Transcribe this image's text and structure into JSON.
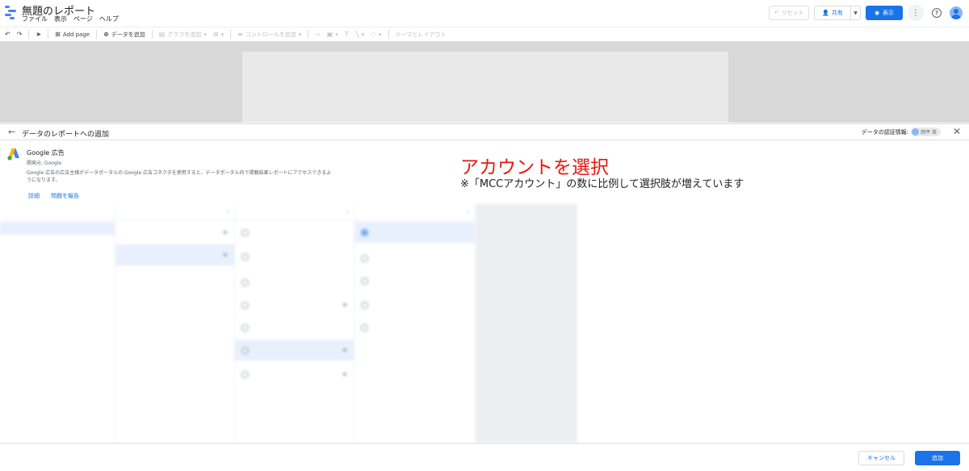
{
  "app": {
    "title": "無題のレポート",
    "menu": [
      "ファイル",
      "表示",
      "ページ",
      "ヘルプ"
    ],
    "reset_label": "リセット",
    "share_label": "共有",
    "view_label": "表示"
  },
  "toolbar": {
    "add_page": "Add page",
    "add_data": "データを追加",
    "add_chart": "グラフを追加",
    "add_control": "コントロールを追加",
    "theme_layout": "テーマとレイアウト"
  },
  "panel": {
    "title": "データのレポートへの追加",
    "credentials_label": "データの認証情報:",
    "credentials_user": "岡平 英"
  },
  "connector": {
    "name": "Google 広告",
    "developer": "開発元: Google",
    "description": "Google 広告の広告主様がデータポータルの Google 広告コネクタを使用すると、データポータル内で掲載結果レポートにアクセスできるようになります。",
    "link_details": "詳細",
    "link_report": "問題を報告"
  },
  "annotation": {
    "title": "アカウントを選択",
    "note": "※「MCCアカウント」の数に比例して選択肢が増えています"
  },
  "columns": {
    "col1": {
      "header": "",
      "rows": [
        {
          "l1": "",
          "l2": ""
        }
      ]
    },
    "col2": {
      "header": "",
      "rows": [
        {
          "l1": "",
          "l2": ""
        },
        {
          "l1": "",
          "l2": ""
        }
      ]
    },
    "col3": {
      "header": "",
      "rows": [
        {
          "l1": "",
          "l2": ""
        },
        {
          "l1": "",
          "l2": ""
        },
        {
          "l1": "",
          "l2": ""
        },
        {
          "l1": "",
          "l2": ""
        },
        {
          "l1": "",
          "l2": ""
        },
        {
          "l1": "",
          "l2": ""
        },
        {
          "l1": "",
          "l2": ""
        }
      ]
    },
    "col4": {
      "header": "",
      "rows": [
        {
          "l1": "",
          "l2": ""
        },
        {
          "l1": "",
          "l2": ""
        },
        {
          "l1": "",
          "l2": ""
        },
        {
          "l1": "",
          "l2": ""
        },
        {
          "l1": "",
          "l2": ""
        }
      ]
    },
    "col5": {
      "header": "",
      "rows": [
        {
          "l1": ""
        },
        {
          "l1": ""
        },
        {
          "l1": ""
        }
      ]
    }
  },
  "footer": {
    "cancel_label": "キャンセル",
    "add_label": "追加"
  },
  "colors": {
    "accent": "#1a73e8",
    "annotation_red": "#e8190f"
  }
}
